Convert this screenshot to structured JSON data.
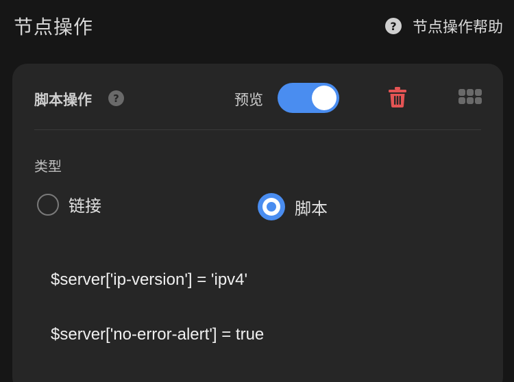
{
  "header": {
    "title": "节点操作",
    "help_icon": "question-circle-icon",
    "help_label": "节点操作帮助"
  },
  "card": {
    "title": "脚本操作",
    "help_icon": "question-circle-icon",
    "preview_label": "预览",
    "preview_enabled": true,
    "delete_icon": "trash-icon",
    "drag_icon": "drag-handle-icon",
    "delete_color": "#e45454"
  },
  "type_field": {
    "label": "类型",
    "options": [
      {
        "label": "链接",
        "selected": false
      },
      {
        "label": "脚本",
        "selected": true
      }
    ]
  },
  "script": {
    "lines": [
      "$server['ip-version'] = 'ipv4'",
      "$server['no-error-alert'] = true"
    ]
  },
  "colors": {
    "accent": "#4a8df0",
    "background": "#161616",
    "card_background": "#262626"
  }
}
